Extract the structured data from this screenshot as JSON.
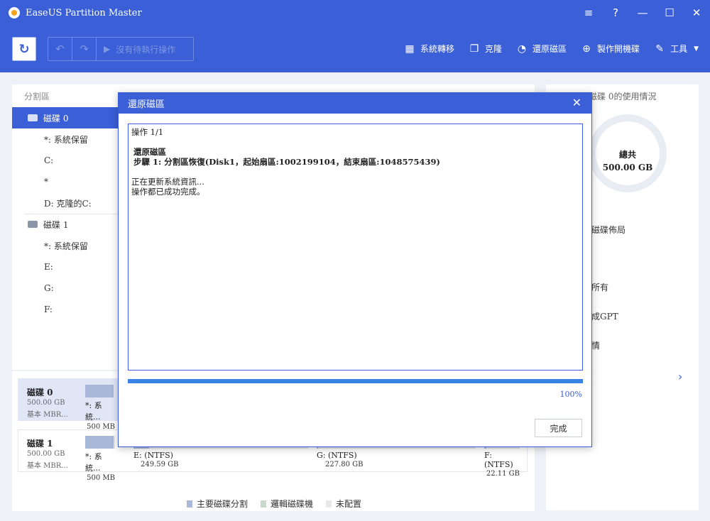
{
  "app": {
    "title": "EaseUS Partition Master"
  },
  "window_controls": {
    "menu": "≡",
    "help": "?",
    "minimize": "—",
    "maximize": "☐",
    "close": "✕"
  },
  "toolbar": {
    "refresh_icon": "↻",
    "undo_icon": "↶",
    "redo_icon": "↷",
    "pending_label": "沒有待執行操作",
    "tools": [
      {
        "label": "系統轉移",
        "icon": "▦"
      },
      {
        "label": "克隆",
        "icon": "❐"
      },
      {
        "label": "還原磁區",
        "icon": "◔"
      },
      {
        "label": "製作開機碟",
        "icon": "⊕"
      },
      {
        "label": "工具",
        "icon": "✎"
      }
    ]
  },
  "left_panel": {
    "header_partition": "分割區",
    "tree": [
      {
        "label": "磁碟 0",
        "type": "disk",
        "selected": true
      },
      {
        "label": "*: 系統保留",
        "type": "part"
      },
      {
        "label": "C:",
        "type": "part"
      },
      {
        "label": "*",
        "type": "part"
      },
      {
        "label": "D: 克隆的C:",
        "type": "part"
      },
      {
        "label": "磁碟 1",
        "type": "disk"
      },
      {
        "label": "*: 系統保留",
        "type": "part"
      },
      {
        "label": "E:",
        "type": "part"
      },
      {
        "label": "G:",
        "type": "part"
      },
      {
        "label": "F:",
        "type": "part"
      }
    ]
  },
  "disk_map": {
    "disks": [
      {
        "name": "磁碟 0",
        "size": "500.00 GB",
        "type": "基本 MBR...",
        "partitions": [
          {
            "label": "*: 系統...",
            "size": "500 MB",
            "used": 0.95
          }
        ]
      },
      {
        "name": "磁碟 1",
        "size": "500.00 GB",
        "type": "基本 MBR...",
        "partitions": [
          {
            "label": "*: 系統...",
            "size": "500 MB",
            "used": 0.95
          },
          {
            "label": "E: (NTFS)",
            "size": "249.59 GB",
            "used": 0.09
          },
          {
            "label": "G: (NTFS)",
            "size": "227.80 GB",
            "used": 0.01
          },
          {
            "label": "F: (NTFS)",
            "size": "22.11 GB",
            "used": 0.05
          }
        ]
      }
    ],
    "legend": [
      {
        "label": "主要磁碟分割",
        "color": "#a9b7d8"
      },
      {
        "label": "邏輯磁碟機",
        "color": "#c9d8cc"
      },
      {
        "label": "未配置",
        "color": "#e8e8e8"
      }
    ]
  },
  "right_panel": {
    "title": "磁碟 0的使用情況",
    "total_label": "總共",
    "total_value": "500.00 GB",
    "links": [
      "磁碟佈局",
      "所有",
      "成GPT",
      "情"
    ],
    "more_icon": "›"
  },
  "dialog": {
    "title": "還原磁區",
    "close_icon": "✕",
    "log": {
      "step_count": "操作 1/1",
      "heading": "還原磁區",
      "step_line": "步驟 1:  分割區恢復(Disk1，起始扇區:1002199104，結束扇區:1048575439)",
      "status_updating": "正在更新系統資訊...",
      "status_done": "操作都已成功完成。"
    },
    "progress": 1.0,
    "progress_text": "100%",
    "finish_button": "完成"
  }
}
